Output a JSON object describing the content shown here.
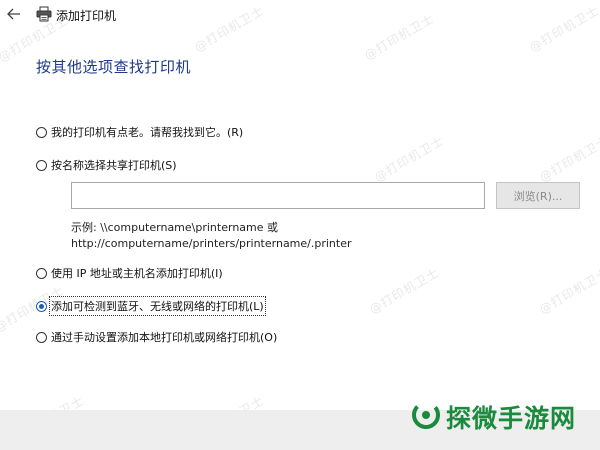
{
  "window": {
    "title": "添加打印机"
  },
  "page": {
    "heading": "按其他选项查找打印机"
  },
  "options": [
    {
      "label": "我的打印机有点老。请帮我找到它。(R)",
      "checked": false
    },
    {
      "label": "按名称选择共享打印机(S)",
      "checked": false
    },
    {
      "label": "使用 IP 地址或主机名添加打印机(I)",
      "checked": false
    },
    {
      "label": "添加可检测到蓝牙、无线或网络的打印机(L)",
      "checked": true
    },
    {
      "label": "通过手动设置添加本地打印机或网络打印机(O)",
      "checked": false
    }
  ],
  "shared_printer": {
    "input_value": "",
    "browse_label": "浏览(R)...",
    "example_line1": "示例: \\\\computername\\printername 或",
    "example_line2": "http://computername/printers/printername/.printer"
  },
  "watermark": "@打印机卫士",
  "brand": {
    "name": "探微手游网",
    "color": "#1a8a3c"
  },
  "colors": {
    "heading": "#1e3a8a",
    "radio_selected": "#1a5fb4"
  }
}
